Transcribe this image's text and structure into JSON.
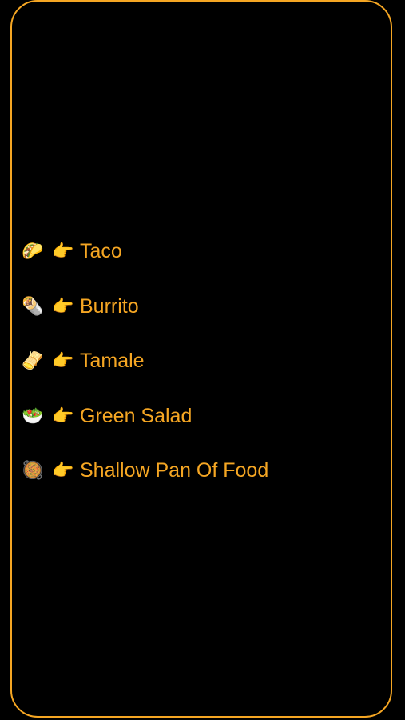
{
  "theme": {
    "accent": "#F5A623",
    "background": "#000000"
  },
  "items": [
    {
      "label": "Taco",
      "icon": "🌮",
      "icon_name": "taco-icon",
      "pointer": "👉",
      "pointer_name": "pointing-hand-icon"
    },
    {
      "label": "Burrito",
      "icon": "🌯",
      "icon_name": "burrito-icon",
      "pointer": "👉",
      "pointer_name": "pointing-hand-icon"
    },
    {
      "label": "Tamale",
      "icon": "🫔",
      "icon_name": "tamale-icon",
      "pointer": "👉",
      "pointer_name": "pointing-hand-icon"
    },
    {
      "label": "Green Salad",
      "icon": "🥗",
      "icon_name": "green-salad-icon",
      "pointer": "👉",
      "pointer_name": "pointing-hand-icon"
    },
    {
      "label": "Shallow Pan Of Food",
      "icon": "🥘",
      "icon_name": "shallow-pan-of-food-icon",
      "pointer": "👉",
      "pointer_name": "pointing-hand-icon"
    }
  ]
}
